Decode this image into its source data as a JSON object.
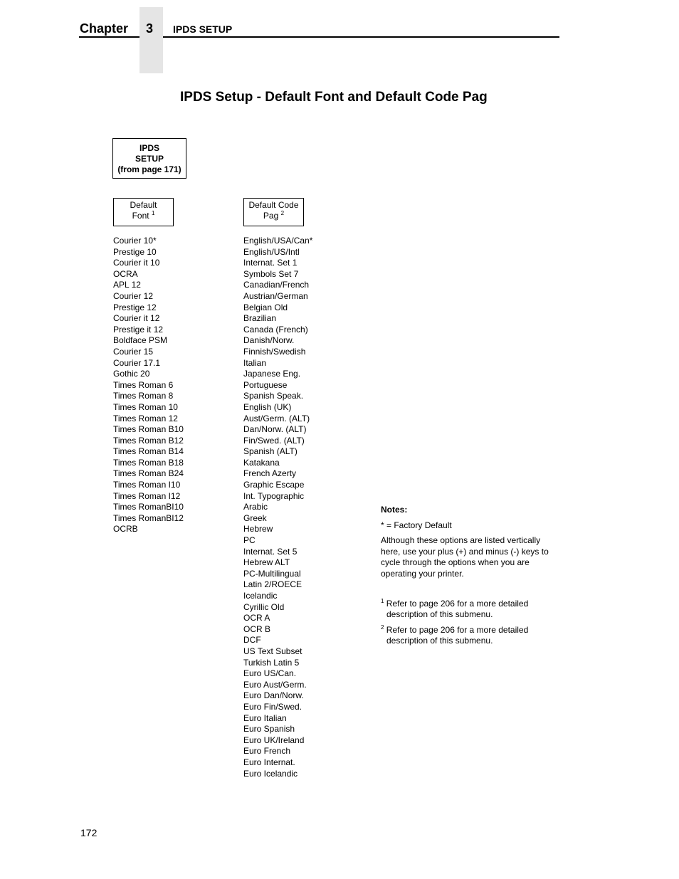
{
  "header": {
    "chapter_label": "Chapter",
    "chapter_number": "3",
    "section_title": "IPDS SETUP"
  },
  "page_heading": "IPDS Setup - Default Font and Default Code Pag",
  "diagram": {
    "root_box": {
      "line1": "IPDS",
      "line2": "SETUP",
      "line3": "(from page 171)"
    },
    "font_box": {
      "line1": "Default",
      "line2": "Font",
      "footnote_ref": "1"
    },
    "codepage_box": {
      "line1": "Default Code",
      "line2": "Pag",
      "footnote_ref": "2"
    }
  },
  "default_font_options": [
    "Courier 10*",
    "Prestige 10",
    "Courier it 10",
    "OCRA",
    "APL 12",
    "Courier 12",
    "Prestige 12",
    "Courier it 12",
    "Prestige it 12",
    "Boldface PSM",
    "Courier 15",
    "Courier 17.1",
    "Gothic 20",
    "Times Roman 6",
    "Times Roman 8",
    "Times Roman 10",
    "Times Roman 12",
    "Times Roman B10",
    "Times Roman B12",
    "Times Roman B14",
    "Times Roman B18",
    "Times Roman B24",
    "Times Roman I10",
    "Times Roman I12",
    "Times RomanBI10",
    "Times RomanBI12",
    "OCRB"
  ],
  "default_code_page_options": [
    "English/USA/Can*",
    "English/US/Intl",
    "Internat. Set 1",
    "Symbols Set 7",
    "Canadian/French",
    "Austrian/German",
    "Belgian Old",
    "Brazilian",
    "Canada (French)",
    "Danish/Norw.",
    "Finnish/Swedish",
    "Italian",
    "Japanese Eng.",
    "Portuguese",
    "Spanish Speak.",
    "English (UK)",
    "Aust/Germ. (ALT)",
    "Dan/Norw. (ALT)",
    "Fin/Swed. (ALT)",
    "Spanish (ALT)",
    "Katakana",
    "French Azerty",
    "Graphic Escape",
    "Int. Typographic",
    "Arabic",
    "Greek",
    "Hebrew",
    "PC",
    "Internat. Set 5",
    "Hebrew ALT",
    "PC-Multilingual",
    "Latin 2/ROECE",
    "Icelandic",
    "Cyrillic Old",
    "OCR A",
    "OCR B",
    "DCF",
    "US Text Subset",
    "Turkish Latin 5",
    "Euro US/Can.",
    "Euro Aust/Germ.",
    "Euro Dan/Norw.",
    "Euro Fin/Swed.",
    "Euro Italian",
    "Euro Spanish",
    "Euro UK/Ireland",
    "Euro French",
    "Euro Internat.",
    "Euro Icelandic"
  ],
  "notes": {
    "title": "Notes:",
    "factory_default": "* = Factory Default",
    "body": "Although these options are listed vertically here, use your plus (+) and minus (-) keys to cycle through the options when you are operating your printer.",
    "footnotes": [
      {
        "mark": "1",
        "text": "Refer to page 206 for a more detailed description of this submenu."
      },
      {
        "mark": "2",
        "text": "Refer to page 206 for a more detailed description of this submenu."
      }
    ]
  },
  "page_number": "172"
}
